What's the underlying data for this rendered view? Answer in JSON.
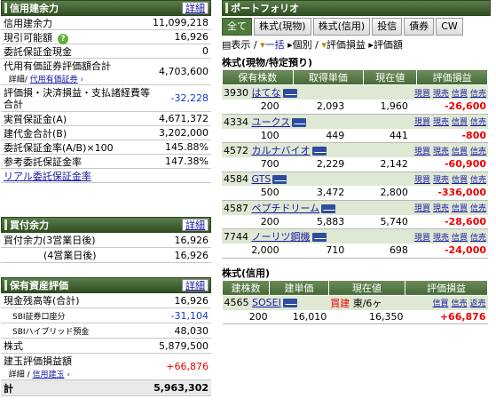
{
  "credit": {
    "title": "信用建余力",
    "detail": "詳細",
    "rows": [
      {
        "label": "信用建余力",
        "value": "11,099,218"
      },
      {
        "label": "現引可能額",
        "value": "16,926"
      },
      {
        "label": "委託保証金現金",
        "value": "0"
      },
      {
        "label": "代用有価証券評価額合計",
        "sub_a": "詳細",
        "sub_b": "代用有価証券",
        "value": "4,703,600"
      },
      {
        "label": "評価損・決済損益・支払諸経費等合計",
        "value": "-32,228"
      },
      {
        "label": "実質保証金(A)",
        "value": "4,671,372"
      },
      {
        "label": "建代金合計(B)",
        "value": "3,202,000"
      },
      {
        "label": "委託保証金率(A/B)×100",
        "value": "145.88%"
      },
      {
        "label": "参考委託保証金率",
        "value": "147.38%"
      }
    ],
    "link": "リアル委託保証金率"
  },
  "buying": {
    "title": "買付余力",
    "detail": "詳細",
    "rows": [
      {
        "label": "買付余力(3営業日後)",
        "value": "16,926"
      },
      {
        "label": "(4営業日後)",
        "value": "16,926"
      }
    ]
  },
  "assets": {
    "title": "保有資産評価",
    "detail": "詳細",
    "rows": [
      {
        "label": "現金残高等(合計)",
        "value": "16,926"
      },
      {
        "label": "SBI証券口座分",
        "value": "-31,104"
      },
      {
        "label": "SBIハイブリッド預金",
        "value": "48,030"
      },
      {
        "label": "株式",
        "value": "5,879,500"
      },
      {
        "label": "建玉評価損益額",
        "sub_a": "詳細",
        "sub_b": "信用建玉",
        "value": "+66,876"
      },
      {
        "label": "計",
        "value": "5,963,302"
      }
    ]
  },
  "portfolio": {
    "title": "ポートフォリオ",
    "tabs": [
      "全て",
      "株式(現物)",
      "株式(信用)",
      "投信",
      "債券",
      "CW"
    ],
    "toolbar": {
      "show": "表示",
      "ikkatsu": "一括",
      "kobetsu": "個別",
      "hyoka": "評価損益",
      "hyokagaku": "評価額"
    },
    "spot_title": "株式(現物/特定預り)",
    "spot_headers": [
      "保有株数",
      "取得単価",
      "現在値",
      "評価損益"
    ],
    "stocks": [
      {
        "code": "3930",
        "name": "はてな",
        "shares": "200",
        "cost": "2,093",
        "price": "1,960",
        "pl": "-26,600"
      },
      {
        "code": "4334",
        "name": "ユークス",
        "shares": "100",
        "cost": "449",
        "price": "441",
        "pl": "-800"
      },
      {
        "code": "4572",
        "name": "カルナバイオ",
        "shares": "700",
        "cost": "2,229",
        "price": "2,142",
        "pl": "-60,900"
      },
      {
        "code": "4584",
        "name": "GTS",
        "shares": "500",
        "cost": "3,472",
        "price": "2,800",
        "pl": "-336,000"
      },
      {
        "code": "4587",
        "name": "ペプチドリーム",
        "shares": "200",
        "cost": "5,883",
        "price": "5,740",
        "pl": "-28,600"
      },
      {
        "code": "7744",
        "name": "ノーリツ鋼機",
        "shares": "2,000",
        "cost": "710",
        "price": "698",
        "pl": "-24,000"
      }
    ],
    "spot_links": [
      "現買",
      "現売",
      "信買",
      "信売"
    ],
    "margin_title": "株式(信用)",
    "margin_headers": [
      "建株数",
      "建単価",
      "現在値",
      "評価損益"
    ],
    "margin": {
      "code": "4565",
      "name": "SOSEI",
      "side": "買建",
      "market": "東/6ヶ",
      "shares": "200",
      "cost": "16,010",
      "price": "16,350",
      "pl": "+66,876"
    },
    "margin_links": [
      "信買",
      "信売",
      "返売"
    ]
  },
  "colors": {
    "header_green": "#456b36",
    "negative": "#e00000",
    "link": "#1a1aa6"
  }
}
